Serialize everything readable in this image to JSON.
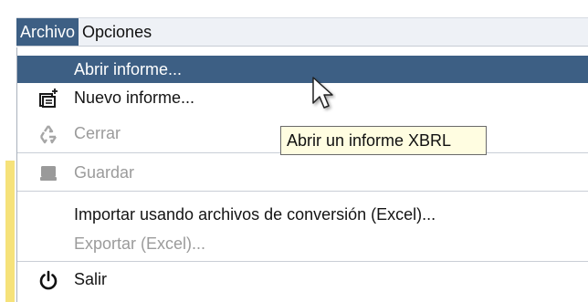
{
  "menubar": {
    "menus": [
      {
        "label": "Archivo",
        "active": true
      },
      {
        "label": "Opciones",
        "active": false
      }
    ]
  },
  "file_menu": {
    "items": [
      {
        "label": "Abrir informe...",
        "icon": "none",
        "state": "highlighted"
      },
      {
        "label": "Nuevo informe...",
        "icon": "new-report-icon",
        "state": "enabled"
      },
      {
        "label": "Cerrar",
        "icon": "recycle-icon",
        "state": "disabled"
      },
      {
        "label": "Guardar",
        "icon": "save-icon",
        "state": "disabled"
      },
      {
        "label": "Importar usando archivos de conversión (Excel)...",
        "icon": "none",
        "state": "enabled"
      },
      {
        "label": "Exportar (Excel)...",
        "icon": "none",
        "state": "disabled"
      },
      {
        "label": "Salir",
        "icon": "power-icon",
        "state": "enabled"
      }
    ]
  },
  "tooltip": {
    "text": "Abrir un informe XBRL"
  },
  "colors": {
    "highlight": "#3d5f84",
    "menubar_bg": "#eef1f6",
    "tooltip_bg": "#fffde1",
    "disabled_text": "#9b9b9b"
  }
}
